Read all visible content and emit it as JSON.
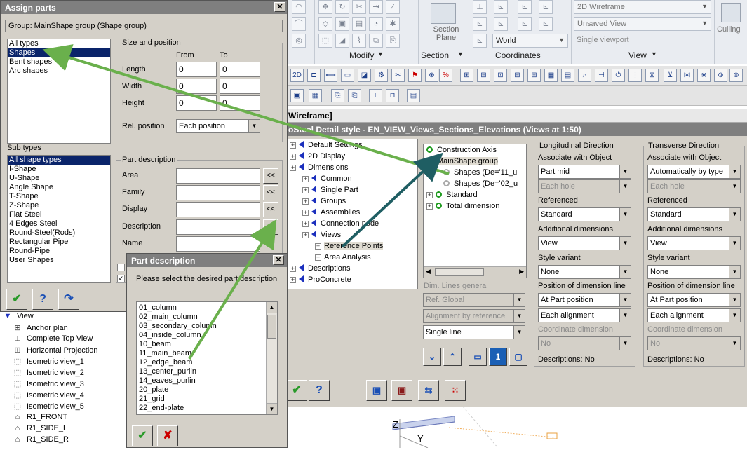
{
  "ribbon": {
    "view_style": "2D Wireframe",
    "saved_view": "Unsaved View",
    "viewport": "Single viewport",
    "section_plane": "Section\nPlane",
    "world": "World",
    "culling": "Culling",
    "panels": [
      "Modify",
      "Section",
      "Coordinates",
      "View"
    ]
  },
  "style_dialog": {
    "wireframe_title": "Wireframe]",
    "title": "oSteel Detail style - EN_VIEW_Views_Sections_Elevations (Views at 1:50)",
    "left_tree": [
      {
        "label": "Default Settings",
        "level": 0
      },
      {
        "label": "2D Display",
        "level": 0
      },
      {
        "label": "Dimensions",
        "level": 0
      },
      {
        "label": "Common",
        "level": 1
      },
      {
        "label": "Single Part",
        "level": 1
      },
      {
        "label": "Groups",
        "level": 1
      },
      {
        "label": "Assemblies",
        "level": 1
      },
      {
        "label": "Connection node",
        "level": 1
      },
      {
        "label": "Views",
        "level": 1
      },
      {
        "label": "Reference Points",
        "level": 2
      },
      {
        "label": "Area Analysis",
        "level": 2
      },
      {
        "label": "Descriptions",
        "level": 0
      },
      {
        "label": "ProConcrete",
        "level": 0
      }
    ],
    "right_tree": [
      {
        "label": "Construction Axis"
      },
      {
        "label": "MainShape group"
      },
      {
        "label": "Shapes (De='11_u"
      },
      {
        "label": "Shapes (De='02_u"
      },
      {
        "label": "Standard"
      },
      {
        "label": "Total dimension"
      }
    ],
    "dim_lines_general": "Dim. Lines general",
    "ref_global": "Ref. Global",
    "alignment": "Alignment by reference",
    "single_line": "Single line",
    "longitudinal": {
      "header": "Longitudinal Direction",
      "assoc_label": "Associate with Object",
      "assoc_value": "Part mid",
      "each_hole": "Each hole",
      "referenced_label": "Referenced",
      "referenced_value": "Standard",
      "additional_label": "Additional dimensions",
      "additional_value": "View",
      "style_label": "Style variant",
      "style_value": "None",
      "position_label": "Position of dimension line",
      "position_value": "At Part position",
      "alignment_value": "Each alignment",
      "coord_label": "Coordinate dimension",
      "coord_value": "No",
      "descriptions": "Descriptions: No"
    },
    "transverse": {
      "header": "Transverse Direction",
      "assoc_label": "Associate with Object",
      "assoc_value": "Automatically by type",
      "each_hole": "Each hole",
      "referenced_label": "Referenced",
      "referenced_value": "Standard",
      "additional_label": "Additional dimensions",
      "additional_value": "View",
      "style_label": "Style variant",
      "style_value": "None",
      "position_label": "Position of dimension line",
      "position_value": "At Part position",
      "alignment_value": "Each alignment",
      "coord_label": "Coordinate dimension",
      "coord_value": "No",
      "descriptions": "Descriptions: No"
    }
  },
  "assign_parts": {
    "title": "Assign parts",
    "group": "Group: MainShape group (Shape group)",
    "types": [
      "All types",
      "Shapes",
      "Bent shapes",
      "Arc shapes"
    ],
    "selected_type": 1,
    "size_position": "Size and position",
    "from": "From",
    "to": "To",
    "length": "Length",
    "width": "Width",
    "height": "Height",
    "zero": "0",
    "rel_position_label": "Rel. position",
    "rel_position_value": "Each position",
    "sub_types_label": "Sub types",
    "sub_types": [
      "All shape types",
      "I-Shape",
      "U-Shape",
      "Angle Shape",
      "T-Shape",
      "Z-Shape",
      "Flat Steel",
      "4 Edges Steel",
      "Round-Steel(Rods)",
      "Rectangular Pipe",
      "Round-Pipe",
      "User Shapes"
    ],
    "part_description": "Part description",
    "area": "Area",
    "family": "Family",
    "display": "Display",
    "description": "Description",
    "name": "Name",
    "picker": "<<"
  },
  "left_tree": {
    "root": "View",
    "items": [
      "Anchor plan",
      "Complete Top View",
      "Horizontal Projection",
      "Isometric view_1",
      "Isometric view_2",
      "Isometric view_3",
      "Isometric view_4",
      "Isometric view_5",
      "R1_FRONT",
      "R1_SIDE_L",
      "R1_SIDE_R"
    ]
  },
  "part_desc_dialog": {
    "title": "Part description",
    "prompt": "Please select the desired part description",
    "items": [
      "01_column",
      "02_main_column",
      "03_secondary_column",
      "04_inside_column",
      "10_beam",
      "11_main_beam",
      "12_edge_beam",
      "13_center_purlin",
      "14_eaves_purlin",
      "20_plate",
      "21_grid",
      "22_end-plate"
    ]
  },
  "colors": {
    "arrow_green": "#6ab04c",
    "arrow_teal": "#1f5e63",
    "selection": "#0a246a",
    "dialog_bg": "#d4d0c8"
  }
}
